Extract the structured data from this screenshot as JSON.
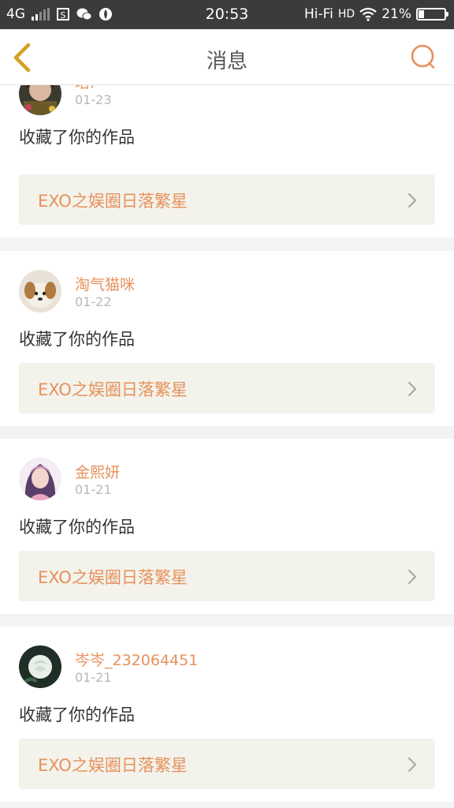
{
  "status_bar": {
    "network": "4G",
    "time": "20:53",
    "hifi": "Hi-Fi",
    "hd": "HD",
    "battery": "21%",
    "battery_level": 0.21
  },
  "header": {
    "title": "消息",
    "back_icon": "chevron-left-icon",
    "search_icon": "search-icon"
  },
  "colors": {
    "accent": "#e7915c",
    "back_icon": "#d4a020",
    "card_bg": "#f3f3ec"
  },
  "messages": [
    {
      "user": "晗.",
      "date": "01-23",
      "action": "收藏了你的作品",
      "work_title": "EXO之娱圈日落繁星"
    },
    {
      "user": "淘气猫咪",
      "date": "01-22",
      "action": "收藏了你的作品",
      "work_title": "EXO之娱圈日落繁星"
    },
    {
      "user": "金熙妍",
      "date": "01-21",
      "action": "收藏了你的作品",
      "work_title": "EXO之娱圈日落繁星"
    },
    {
      "user": "岑岑_232064451",
      "date": "01-21",
      "action": "收藏了你的作品",
      "work_title": "EXO之娱圈日落繁星"
    }
  ]
}
